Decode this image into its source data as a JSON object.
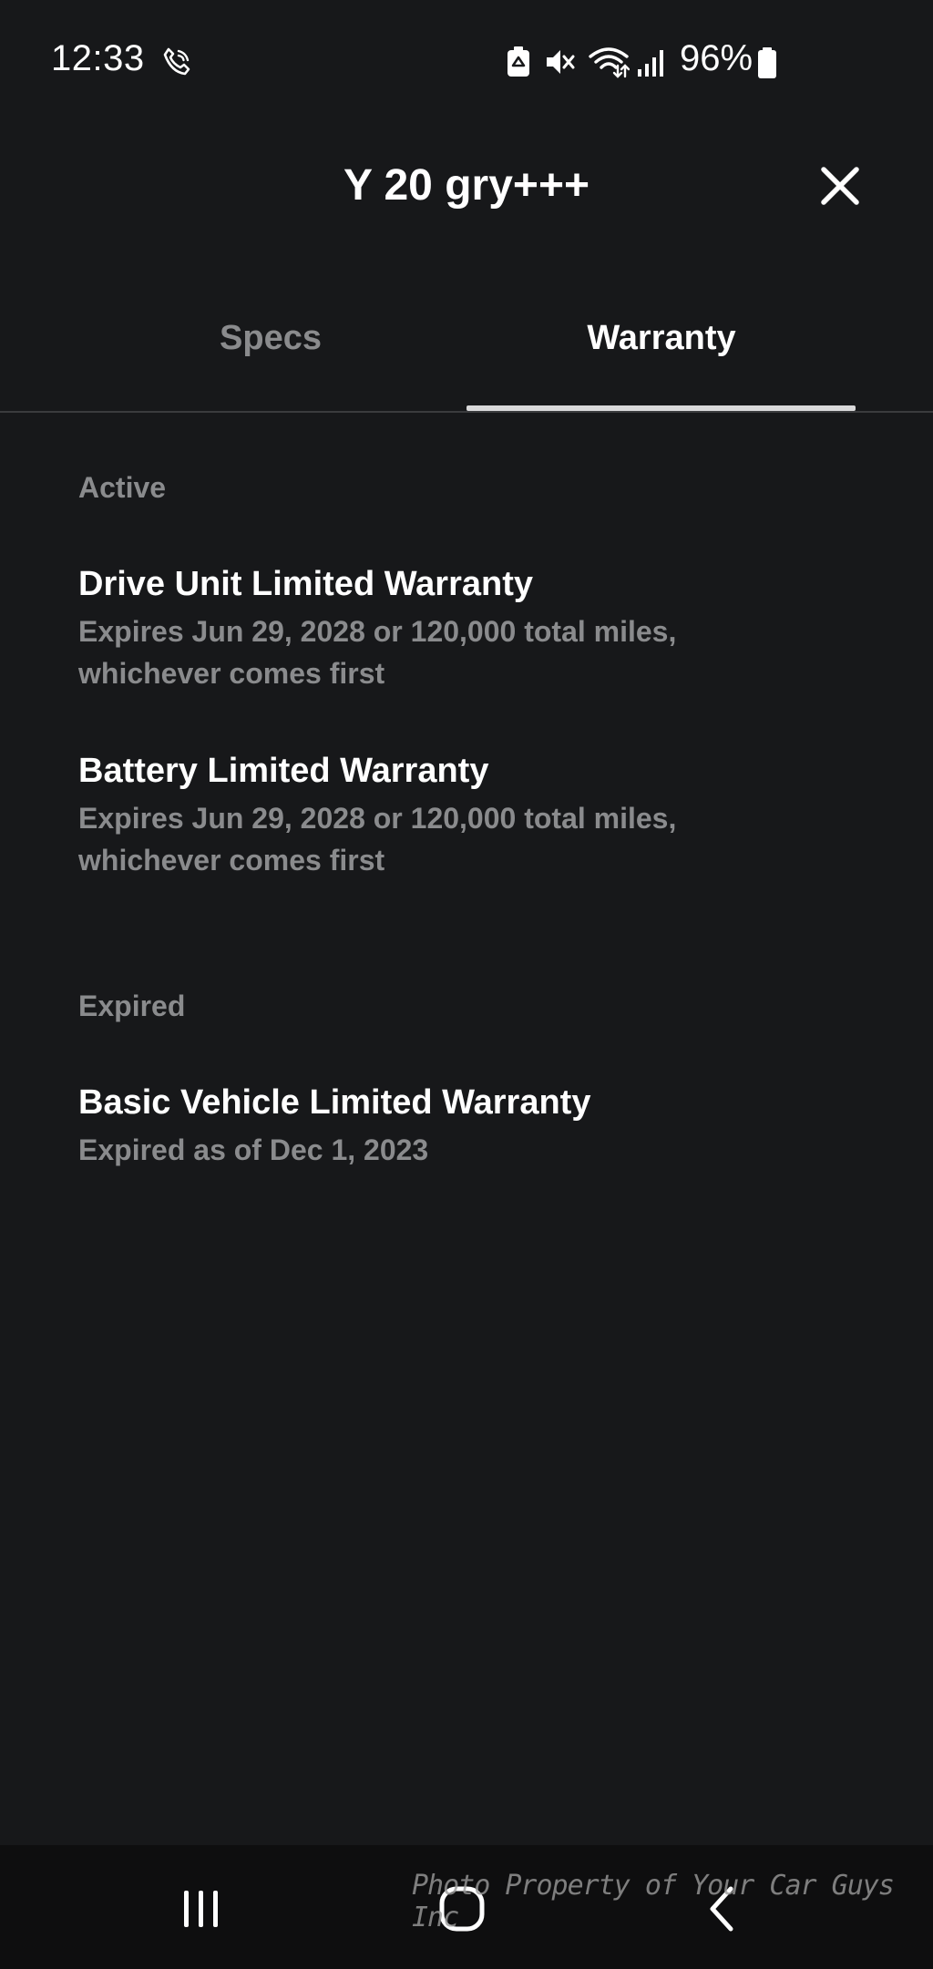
{
  "status_bar": {
    "time": "12:33",
    "battery_percent": "96%",
    "icons": [
      "wifi-call-icon",
      "battery-saver-icon",
      "mute-icon",
      "wifi-icon",
      "signal-icon",
      "battery-icon"
    ]
  },
  "header": {
    "title": "Y 20 gry+++",
    "close_icon": "close-icon"
  },
  "tabs": [
    {
      "label": "Specs",
      "selected": false
    },
    {
      "label": "Warranty",
      "selected": true
    }
  ],
  "sections": [
    {
      "label": "Active",
      "items": [
        {
          "title": "Drive Unit Limited Warranty",
          "desc": "Expires Jun 29, 2028 or 120,000 total miles, whichever comes first"
        },
        {
          "title": "Battery Limited Warranty",
          "desc": "Expires Jun 29, 2028 or 120,000 total miles, whichever comes first"
        }
      ]
    },
    {
      "label": "Expired",
      "items": [
        {
          "title": "Basic Vehicle Limited Warranty",
          "desc": "Expired as of Dec 1, 2023"
        }
      ]
    }
  ],
  "nav_bar": {
    "buttons": [
      "recents-icon",
      "home-icon",
      "back-icon"
    ]
  },
  "watermark": "Photo Property of Your Car Guys Inc",
  "colors": {
    "background": "#17181a",
    "text_primary": "#ffffff",
    "text_secondary": "#8a8b8d",
    "tab_indicator": "#d9d9da"
  }
}
